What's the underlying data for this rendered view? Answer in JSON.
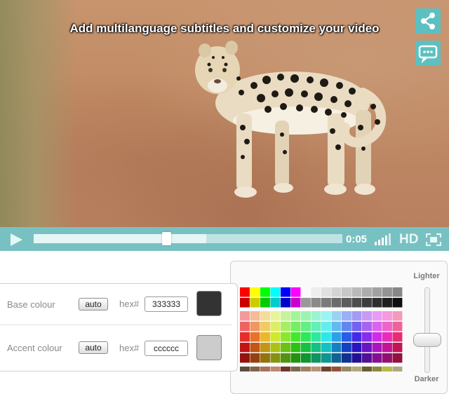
{
  "player": {
    "subtitle": "Add multilanguage subtitles and customize your video",
    "share_icon": "share-icon",
    "comment_icon": "comment-icon",
    "play_icon": "play-icon",
    "time": "0:05",
    "progress": 0.43,
    "buffered": 0.56,
    "volume_icon": "volume-bars-icon",
    "hd_label": "HD",
    "fullscreen_icon": "fullscreen-icon",
    "accent_color": "#78c1c3"
  },
  "settings": {
    "base": {
      "label": "Base colour",
      "auto_label": "auto",
      "hex_label": "hex#",
      "hex_value": "333333",
      "swatch": "#333333"
    },
    "accent": {
      "label": "Accent colour",
      "auto_label": "auto",
      "hex_label": "hex#",
      "hex_value": "cccccc",
      "swatch": "#cccccc"
    },
    "slider": {
      "top_label": "Lighter",
      "bottom_label": "Darker",
      "level": 0.75
    }
  }
}
